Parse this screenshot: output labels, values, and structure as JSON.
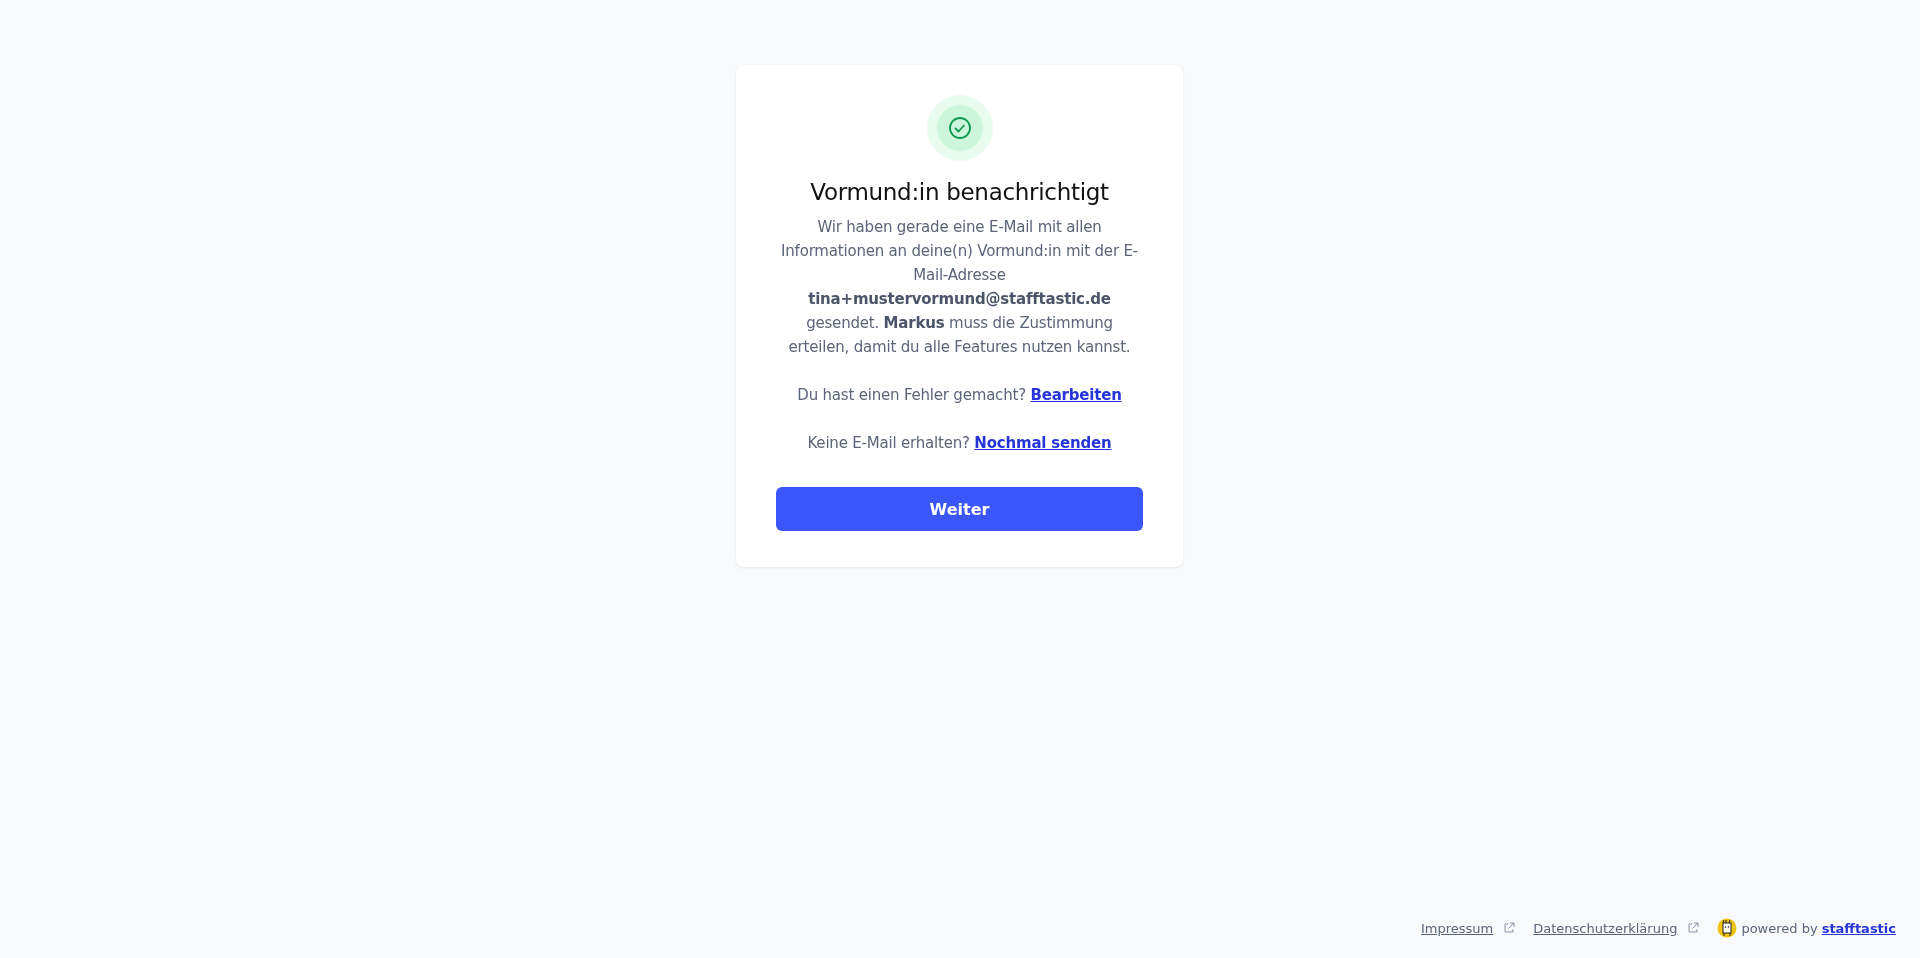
{
  "card": {
    "title": "Vormund:in benachrichtigt",
    "message": "Wir haben gerade eine E-Mail mit allen Informationen an deine(n) Vormund:in mit der E-Mail-Adresse **tina+mustervormund@stafftastic.de** gesendet. **Markus** muss die Zustimmung erteilen, damit du alle Features nutzen kannst.",
    "prompts": [
      {
        "text": "Du hast einen Fehler gemacht?",
        "link": "Bearbeiten"
      },
      {
        "text": "Keine E-Mail erhalten?",
        "link": "Nochmal senden"
      }
    ],
    "button": "Weiter"
  },
  "footer": {
    "links": [
      "Impressum",
      "Datenschutzerklärung"
    ],
    "powered_by": "powered by",
    "brand": "stafftastic"
  }
}
